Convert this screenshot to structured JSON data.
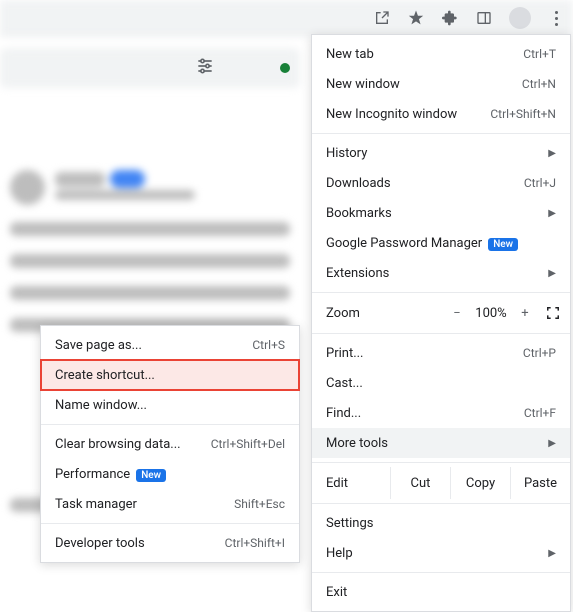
{
  "toolbar": {
    "icons": [
      "share-icon",
      "bookmark-star-icon",
      "extensions-icon",
      "sidepanel-icon",
      "profile-icon",
      "more-icon"
    ]
  },
  "main_menu": {
    "items_a": [
      {
        "label": "New tab",
        "shortcut": "Ctrl+T"
      },
      {
        "label": "New window",
        "shortcut": "Ctrl+N"
      },
      {
        "label": "New Incognito window",
        "shortcut": "Ctrl+Shift+N"
      }
    ],
    "items_b": [
      {
        "label": "History",
        "arrow": true
      },
      {
        "label": "Downloads",
        "shortcut": "Ctrl+J"
      },
      {
        "label": "Bookmarks",
        "arrow": true
      },
      {
        "label": "Google Password Manager",
        "badge": "New"
      },
      {
        "label": "Extensions",
        "arrow": true
      }
    ],
    "zoom": {
      "label": "Zoom",
      "minus": "−",
      "percent": "100%",
      "plus": "+"
    },
    "items_c": [
      {
        "label": "Print...",
        "shortcut": "Ctrl+P"
      },
      {
        "label": "Cast..."
      },
      {
        "label": "Find...",
        "shortcut": "Ctrl+F"
      },
      {
        "label": "More tools",
        "arrow": true,
        "highlight": true
      }
    ],
    "edit": {
      "label": "Edit",
      "cut": "Cut",
      "copy": "Copy",
      "paste": "Paste"
    },
    "items_d": [
      {
        "label": "Settings"
      },
      {
        "label": "Help",
        "arrow": true
      }
    ],
    "items_e": [
      {
        "label": "Exit"
      }
    ]
  },
  "sub_menu": {
    "items_a": [
      {
        "label": "Save page as...",
        "shortcut": "Ctrl+S"
      },
      {
        "label": "Create shortcut...",
        "highlight": true
      },
      {
        "label": "Name window..."
      }
    ],
    "items_b": [
      {
        "label": "Clear browsing data...",
        "shortcut": "Ctrl+Shift+Del"
      },
      {
        "label": "Performance",
        "badge": "New"
      },
      {
        "label": "Task manager",
        "shortcut": "Shift+Esc"
      }
    ],
    "items_c": [
      {
        "label": "Developer tools",
        "shortcut": "Ctrl+Shift+I"
      }
    ]
  }
}
